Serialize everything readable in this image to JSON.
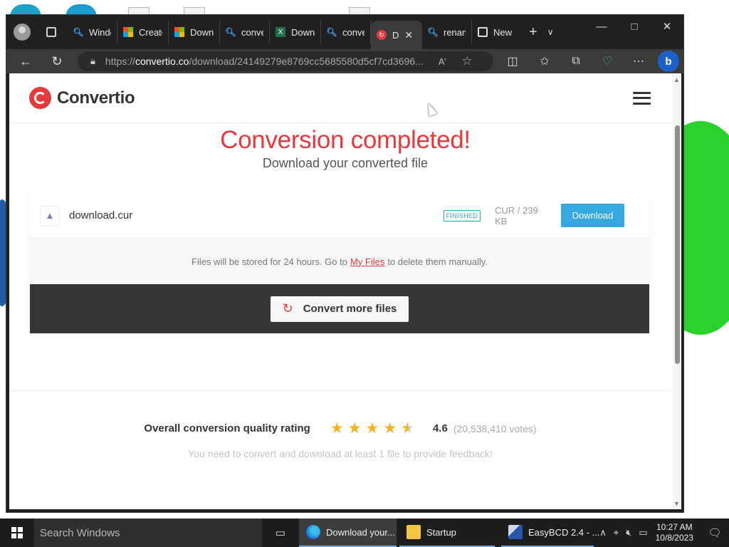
{
  "browser": {
    "tabs": [
      {
        "label": "Windo",
        "icon": "search-icon"
      },
      {
        "label": "Create",
        "icon": "microsoft-icon"
      },
      {
        "label": "Downl",
        "icon": "microsoft-icon"
      },
      {
        "label": "conve",
        "icon": "search-icon"
      },
      {
        "label": "Downl",
        "icon": "excel-icon"
      },
      {
        "label": "conve",
        "icon": "search-icon"
      },
      {
        "label": "D",
        "icon": "convertio-icon",
        "active": true
      },
      {
        "label": "renam",
        "icon": "search-icon"
      },
      {
        "label": "New t",
        "icon": "newtab-icon"
      }
    ],
    "url_prefix": "https://",
    "url_host": "convertio.co",
    "url_path": "/download/24149279e8769cc5685580d5cf7cd3696..."
  },
  "site": {
    "logo_text": "Convertio"
  },
  "main": {
    "title": "Conversion completed!",
    "subtitle": "Download your converted file",
    "file": {
      "name": "download.cur",
      "status": "FINISHED",
      "meta": "CUR / 239 KB",
      "download_label": "Download"
    },
    "notice_before": "Files will be stored for 24 hours. Go to",
    "notice_link": "My Files",
    "notice_after": "to delete them manually.",
    "convert_more_label": "Convert more files"
  },
  "rating": {
    "label": "Overall conversion quality rating",
    "value": 4.6,
    "score": "4.6",
    "votes": "(20,538,410 votes)",
    "feedback": "You need to convert and download at least 1 file to provide feedback!"
  },
  "taskbar": {
    "search_placeholder": "Search Windows",
    "apps": [
      {
        "label": "Download your...",
        "active": true
      },
      {
        "label": "Startup",
        "active": false
      },
      {
        "label": "EasyBCD 2.4 - ...",
        "active": false
      }
    ],
    "time": "10:27 AM",
    "date": "10/8/2023"
  },
  "colors": {
    "brand_red": "#e8383d",
    "download_blue": "#35a8e0",
    "finished_teal": "#2aa8b5",
    "star_gold": "#f7b21d"
  }
}
